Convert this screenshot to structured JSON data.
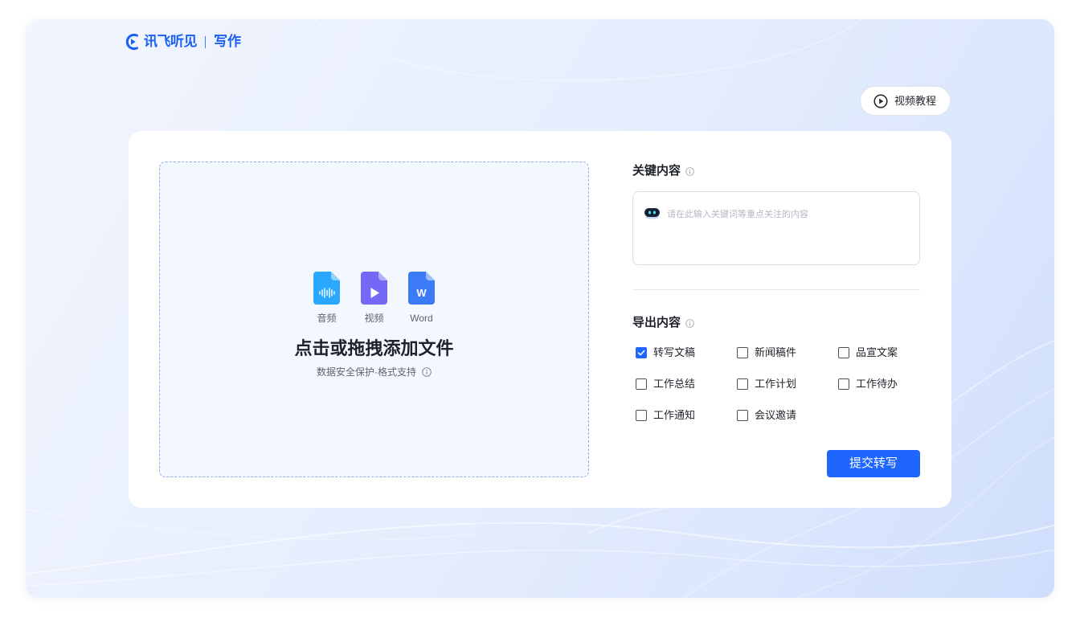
{
  "app": {
    "brand_name": "讯飞听见",
    "product_name": "写作",
    "logo_icon": "ear-play-logo-icon"
  },
  "header": {
    "tutorial_button_label": "视频教程",
    "tutorial_icon": "play-circle-icon"
  },
  "upload": {
    "file_types": [
      {
        "label": "音频",
        "icon": "audio-file-icon",
        "color": "#2aa7ff"
      },
      {
        "label": "视频",
        "icon": "video-file-icon",
        "color": "#7468f7"
      },
      {
        "label": "Word",
        "icon": "word-file-icon",
        "color": "#3d7af5",
        "glyph": "W"
      }
    ],
    "title": "点击或拖拽添加文件",
    "hint": "数据安全保护·格式支持",
    "hint_icon": "info-icon"
  },
  "key_content": {
    "label": "关键内容",
    "label_icon": "info-icon",
    "input_icon": "robot-icon",
    "placeholder": "请在此输入关键词等重点关注的内容"
  },
  "export_content": {
    "label": "导出内容",
    "label_icon": "info-icon",
    "options": [
      {
        "label": "转写文稿",
        "checked": true
      },
      {
        "label": "新闻稿件",
        "checked": false
      },
      {
        "label": "品宣文案",
        "checked": false
      },
      {
        "label": "工作总结",
        "checked": false
      },
      {
        "label": "工作计划",
        "checked": false
      },
      {
        "label": "工作待办",
        "checked": false
      },
      {
        "label": "工作通知",
        "checked": false
      },
      {
        "label": "会议邀请",
        "checked": false
      }
    ]
  },
  "submit_button_label": "提交转写",
  "colors": {
    "accent": "#1f66ff",
    "brand": "#1a5ff4",
    "dropzone_background": "#f3f7fe",
    "dropzone_border": "#8eaeea"
  }
}
